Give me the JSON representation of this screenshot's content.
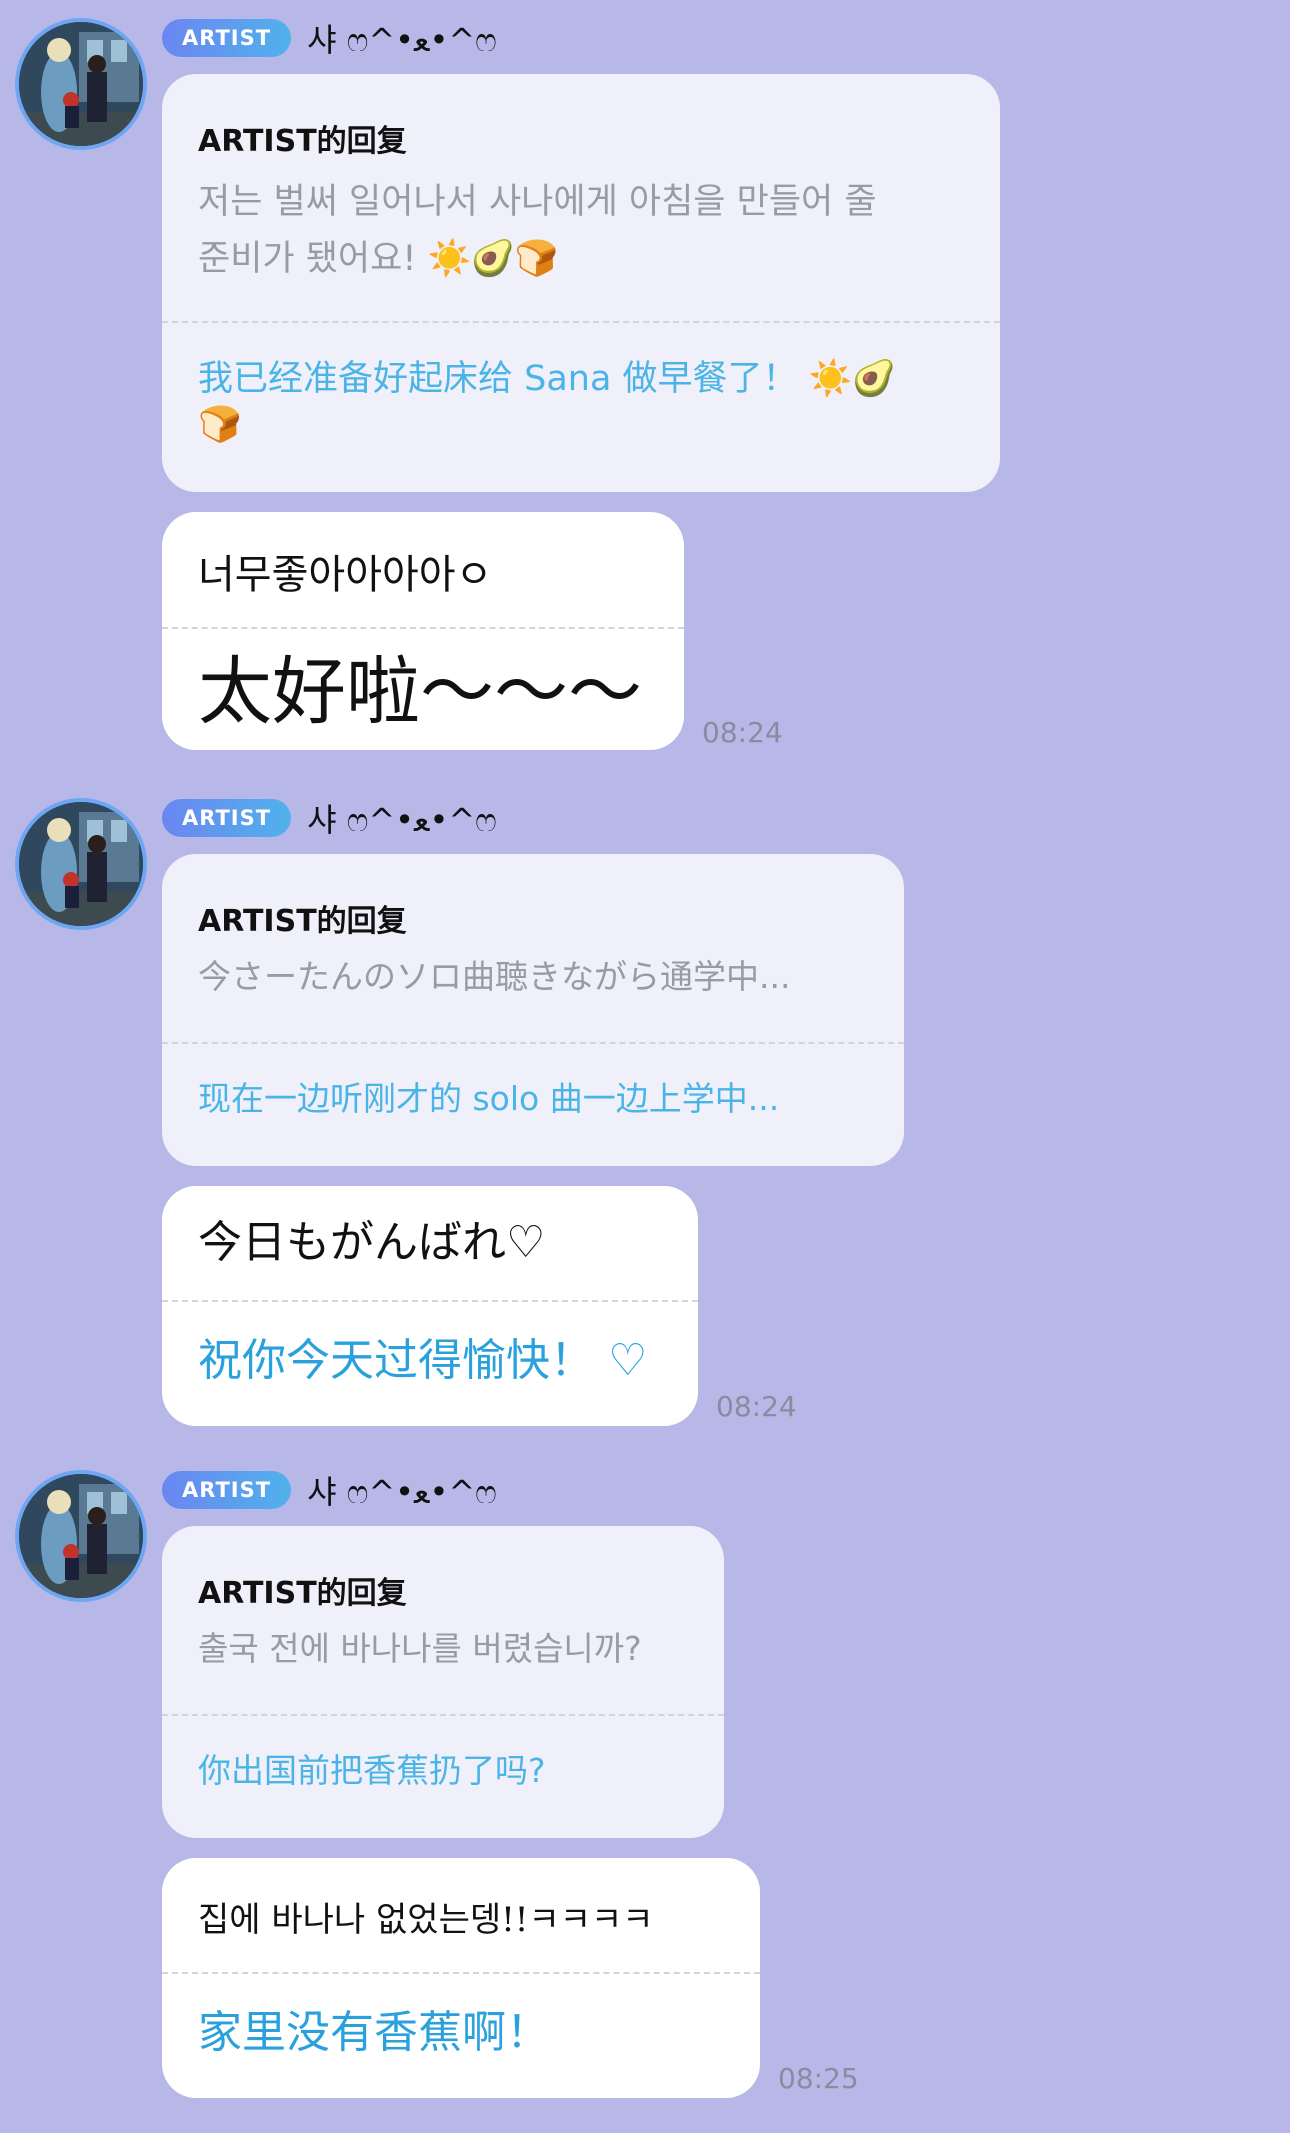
{
  "messages": [
    {
      "badge": "ARTIST",
      "nickname": "샤 ෆ^•ﻌ•^ෆ",
      "reply_title": "ARTIST的回复",
      "original_line1": "저는 벌써 일어나서 사나에게 아침을 만들어 줄",
      "original_line2": "준비가 됐어요! ☀️🥑🍞",
      "translation_line1": "我已经准备好起床给 Sana 做早餐了！ ☀️🥑",
      "translation_line2": "🍞",
      "fan_text": "너무좋아아아아ㅇ",
      "fan_translation": "太好啦～～～",
      "time": "08:24"
    },
    {
      "badge": "ARTIST",
      "nickname": "샤 ෆ^•ﻌ•^ෆ",
      "reply_title": "ARTIST的回复",
      "original_line1": "今さーたんのソロ曲聴きながら通学中...",
      "translation_line1": "现在一边听刚才的 solo 曲一边上学中...",
      "fan_text": "今日もがんばれ♡",
      "fan_translation": "祝你今天过得愉快！ ♡",
      "time": "08:24"
    },
    {
      "badge": "ARTIST",
      "nickname": "샤 ෆ^•ﻌ•^ෆ",
      "reply_title": "ARTIST的回复",
      "original_line1": "출국 전에 바나나를 버렸습니까?",
      "translation_line1": "你出国前把香蕉扔了吗?",
      "fan_text": "집에 바나나 없었는뎅!!ㅋㅋㅋㅋ",
      "fan_translation": "家里没有香蕉啊！",
      "time": "08:25"
    }
  ],
  "colors": {
    "background": "#b8b8e8",
    "translation": "#4bb4e6",
    "badge_start": "#6b86f1",
    "badge_end": "#51b1ec"
  }
}
